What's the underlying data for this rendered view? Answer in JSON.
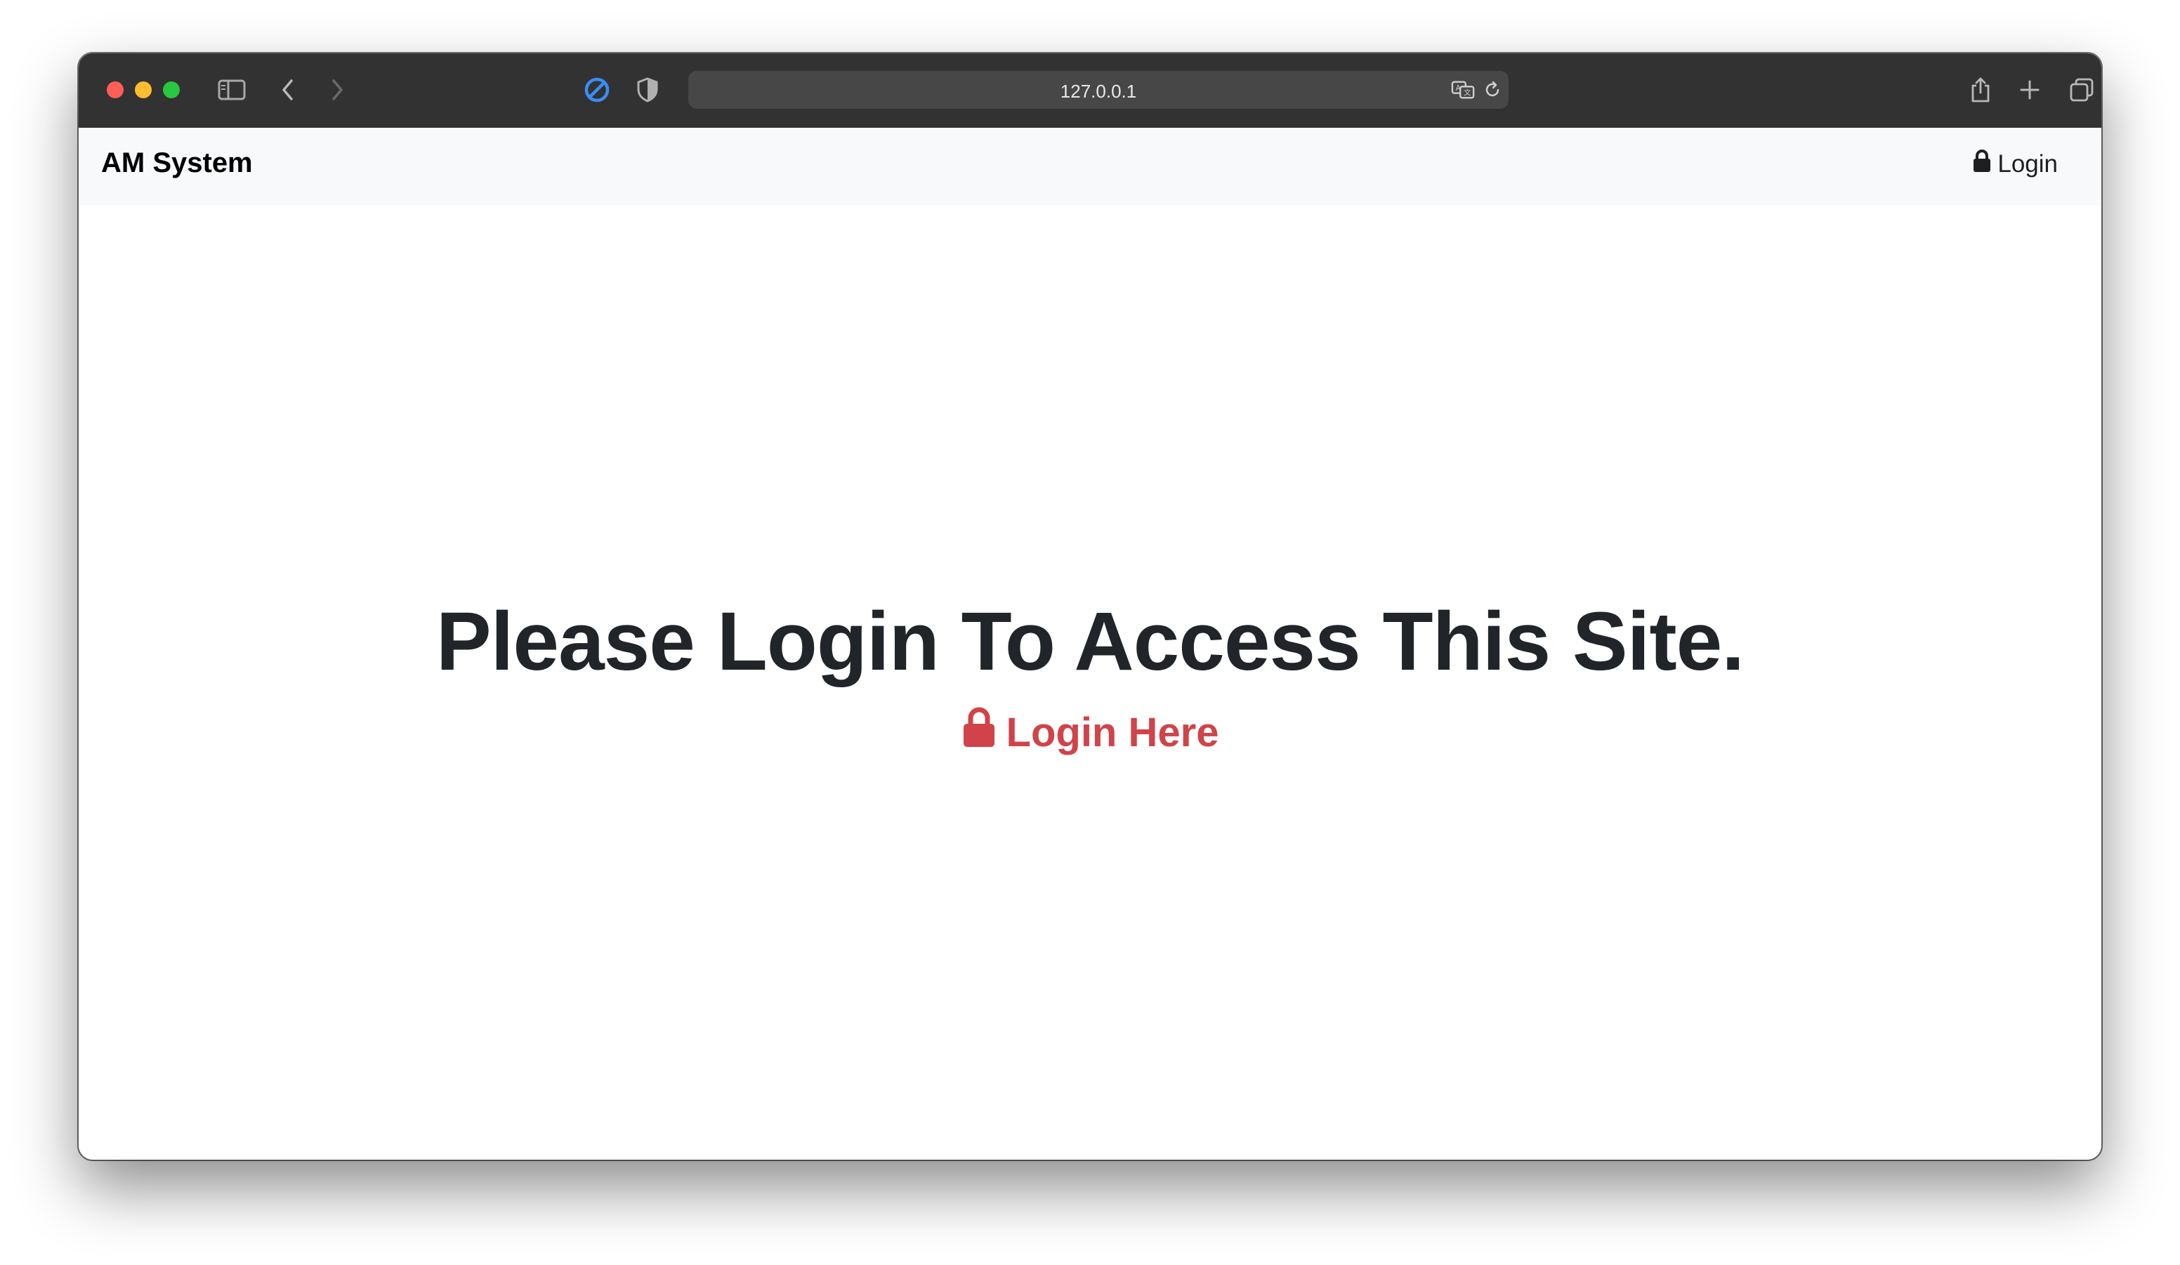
{
  "browser": {
    "url": "127.0.0.1",
    "icons": {
      "sidebar": "sidebar-icon",
      "back": "chevron-left-icon",
      "forward": "chevron-right-icon",
      "blocker": "blocker-icon",
      "privacy": "shield-icon",
      "translate": "translate-icon",
      "reload": "reload-icon",
      "share": "share-icon",
      "new_tab": "plus-icon",
      "tabs": "tabs-overview-icon"
    }
  },
  "navbar": {
    "brand": "AM System",
    "login_label": "Login",
    "login_icon": "lock-icon"
  },
  "main": {
    "headline": "Please Login To Access This Site.",
    "login_link_label": "Login Here",
    "login_link_icon": "lock-icon"
  },
  "colors": {
    "toolbar": "#323232",
    "navbar_bg": "#f8f9fa",
    "headline": "#212529",
    "link_red": "#d04349"
  }
}
